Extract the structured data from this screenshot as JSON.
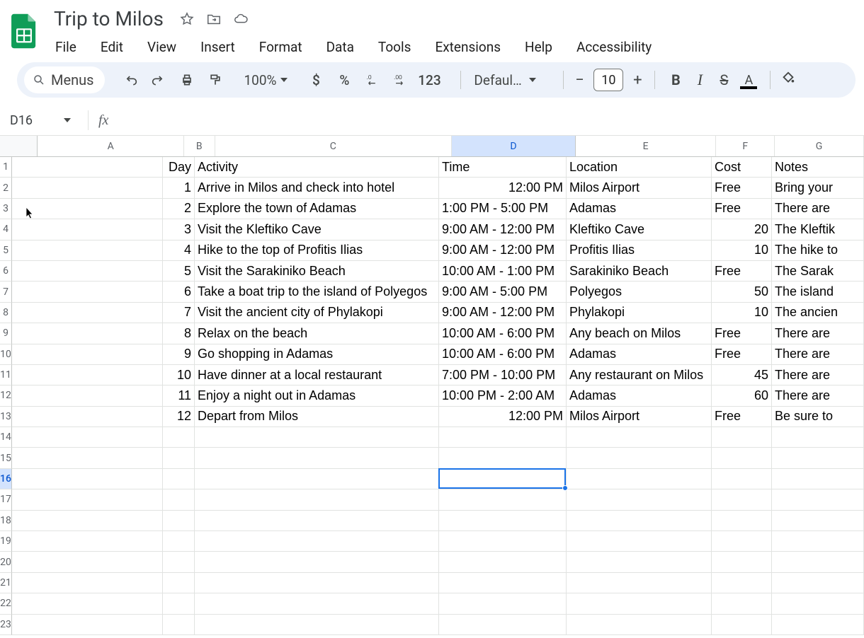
{
  "app": {
    "doc_title": "Trip to Milos",
    "icon_name": "sheets-app-icon"
  },
  "title_icons": {
    "star": "star-icon",
    "move": "move-to-folder-icon",
    "cloud": "cloud-saved-icon"
  },
  "menubar": [
    "File",
    "Edit",
    "View",
    "Insert",
    "Format",
    "Data",
    "Tools",
    "Extensions",
    "Help",
    "Accessibility"
  ],
  "toolbar": {
    "menus_label": "Menus",
    "zoom": "100%",
    "currency": "$",
    "percent": "%",
    "num_format": "123",
    "font_name": "Defaul…",
    "font_size": "10",
    "bold": "B",
    "italic": "I",
    "strike": "S",
    "text_color_letter": "A"
  },
  "fx": {
    "namebox": "D16",
    "formula": ""
  },
  "sheet": {
    "columns": [
      "A",
      "B",
      "C",
      "D",
      "E",
      "F",
      "G"
    ],
    "selected_col": "D",
    "selected_row": 16,
    "row_count": 23,
    "headers": {
      "B": "Day",
      "C": "Activity",
      "D": "Time",
      "E": "Location",
      "F": "Cost",
      "G": "Notes"
    },
    "rows": [
      {
        "day": "1",
        "activity": "Arrive in Milos and check into hotel",
        "time": "12:00 PM",
        "location": "Milos Airport",
        "cost": "Free",
        "notes": "Bring your"
      },
      {
        "day": "2",
        "activity": "Explore the town of Adamas",
        "time": "1:00 PM - 5:00 PM",
        "location": "Adamas",
        "cost": "Free",
        "notes": "There are"
      },
      {
        "day": "3",
        "activity": "Visit the Kleftiko Cave",
        "time": "9:00 AM - 12:00 PM",
        "location": "Kleftiko Cave",
        "cost": "20",
        "notes": "The Kleftik"
      },
      {
        "day": "4",
        "activity": "Hike to the top of Profitis Ilias",
        "time": "9:00 AM - 12:00 PM",
        "location": "Profitis Ilias",
        "cost": "10",
        "notes": "The hike to"
      },
      {
        "day": "5",
        "activity": "Visit the Sarakiniko Beach",
        "time": "10:00 AM - 1:00 PM",
        "location": "Sarakiniko Beach",
        "cost": "Free",
        "notes": "The Sarak"
      },
      {
        "day": "6",
        "activity": "Take a boat trip to the island of Polyegos",
        "time": "9:00 AM - 5:00 PM",
        "location": "Polyegos",
        "cost": "50",
        "notes": "The island"
      },
      {
        "day": "7",
        "activity": "Visit the ancient city of Phylakopi",
        "time": "9:00 AM - 12:00 PM",
        "location": "Phylakopi",
        "cost": "10",
        "notes": "The ancien"
      },
      {
        "day": "8",
        "activity": "Relax on the beach",
        "time": "10:00 AM - 6:00 PM",
        "location": "Any beach on Milos",
        "cost": "Free",
        "notes": "There are"
      },
      {
        "day": "9",
        "activity": "Go shopping in Adamas",
        "time": "10:00 AM - 6:00 PM",
        "location": "Adamas",
        "cost": "Free",
        "notes": "There are"
      },
      {
        "day": "10",
        "activity": "Have dinner at a local restaurant",
        "time": "7:00 PM - 10:00 PM",
        "location": "Any restaurant on Milos",
        "cost": "45",
        "notes": "There are"
      },
      {
        "day": "11",
        "activity": "Enjoy a night out in Adamas",
        "time": "10:00 PM - 2:00 AM",
        "location": "Adamas",
        "cost": "60",
        "notes": "There are"
      },
      {
        "day": "12",
        "activity": "Depart from Milos",
        "time": "12:00 PM",
        "location": "Milos Airport",
        "cost": "Free",
        "notes": "Be sure to"
      }
    ]
  }
}
